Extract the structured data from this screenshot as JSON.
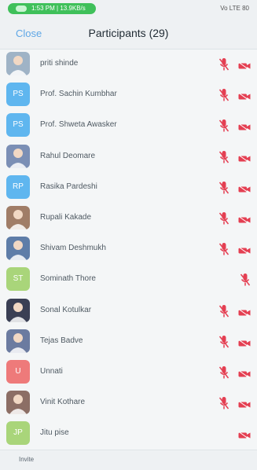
{
  "status_bar": {
    "pill_text": "1:53 PM | 13.9KB/s",
    "right_text": "Vo LTE  80"
  },
  "header": {
    "close_label": "Close",
    "title": "Participants (29)"
  },
  "footer": {
    "invite_label": "Invite"
  },
  "colors": {
    "mic_muted": "#e43f52",
    "cam_off": "#e43f52",
    "avatar_blue": "#5fb6ef",
    "avatar_green": "#a9d57a",
    "avatar_red": "#ee7a7a"
  },
  "participants": [
    {
      "name": "priti shinde",
      "initials": "",
      "avatar": "photo",
      "mic_muted": true,
      "cam_off": true
    },
    {
      "name": "Prof. Sachin Kumbhar",
      "initials": "PS",
      "avatar": "blue",
      "mic_muted": true,
      "cam_off": true
    },
    {
      "name": "Prof. Shweta Awasker",
      "initials": "PS",
      "avatar": "blue",
      "mic_muted": true,
      "cam_off": true
    },
    {
      "name": "Rahul Deomare",
      "initials": "",
      "avatar": "photo",
      "mic_muted": true,
      "cam_off": true
    },
    {
      "name": "Rasika Pardeshi",
      "initials": "RP",
      "avatar": "blue",
      "mic_muted": true,
      "cam_off": true
    },
    {
      "name": "Rupali Kakade",
      "initials": "",
      "avatar": "photo",
      "mic_muted": true,
      "cam_off": true
    },
    {
      "name": "Shivam Deshmukh",
      "initials": "",
      "avatar": "photo",
      "mic_muted": true,
      "cam_off": true
    },
    {
      "name": "Sominath Thore",
      "initials": "ST",
      "avatar": "green",
      "mic_muted": true,
      "cam_off": false
    },
    {
      "name": "Sonal Kotulkar",
      "initials": "",
      "avatar": "photo",
      "mic_muted": true,
      "cam_off": true
    },
    {
      "name": "Tejas Badve",
      "initials": "",
      "avatar": "photo",
      "mic_muted": true,
      "cam_off": true
    },
    {
      "name": "Unnati",
      "initials": "U",
      "avatar": "red",
      "mic_muted": true,
      "cam_off": true
    },
    {
      "name": "Vinit Kothare",
      "initials": "",
      "avatar": "photo",
      "mic_muted": true,
      "cam_off": true
    },
    {
      "name": "Jitu pise",
      "initials": "JP",
      "avatar": "green",
      "mic_muted": false,
      "cam_off": true
    }
  ]
}
